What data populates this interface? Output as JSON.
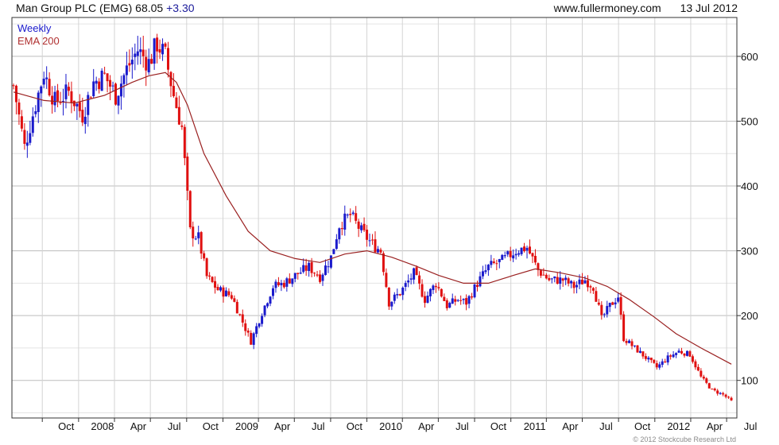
{
  "header": {
    "instrument": "Man Group PLC (EMG)",
    "price": "68.05",
    "change": "+3.30",
    "site": "www.fullermoney.com",
    "date": "13 Jul 2012"
  },
  "legend": {
    "weekly": "Weekly",
    "ema": "EMA 200"
  },
  "copyright": "© 2012 Stockcube Research Ltd",
  "colors": {
    "up": "#1a1acc",
    "down": "#e01010",
    "ema": "#9a2020",
    "grid": "#c8c8c8",
    "frame": "#333333"
  },
  "chart_data": {
    "type": "line",
    "title": "Man Group PLC (EMG)",
    "xlabel": "",
    "ylabel": "",
    "x_ticks": [
      "Oct",
      "2008",
      "Apr",
      "Jul",
      "Oct",
      "2009",
      "Apr",
      "Jul",
      "Oct",
      "2010",
      "Apr",
      "Jul",
      "Oct",
      "2011",
      "Apr",
      "Jul",
      "Oct",
      "2012",
      "Apr",
      "Jul"
    ],
    "y_ticks": [
      100,
      200,
      300,
      400,
      500,
      600
    ],
    "ylim": [
      42,
      660
    ],
    "xlim": [
      "2007-07-16",
      "2012-07-27"
    ],
    "grid": true,
    "legend_position": "top-left",
    "series": [
      {
        "name": "Weekly",
        "style": "candles",
        "anchors": [
          [
            "2007-07-20",
            555
          ],
          [
            "2007-08-17",
            460
          ],
          [
            "2007-09-07",
            510
          ],
          [
            "2007-10-05",
            575
          ],
          [
            "2007-11-02",
            530
          ],
          [
            "2007-12-07",
            545
          ],
          [
            "2008-01-11",
            510
          ],
          [
            "2008-02-08",
            560
          ],
          [
            "2008-03-07",
            570
          ],
          [
            "2008-04-04",
            540
          ],
          [
            "2008-05-02",
            580
          ],
          [
            "2008-05-30",
            610
          ],
          [
            "2008-06-27",
            590
          ],
          [
            "2008-07-18",
            620
          ],
          [
            "2008-08-08",
            600
          ],
          [
            "2008-08-29",
            540
          ],
          [
            "2008-09-19",
            490
          ],
          [
            "2008-10-10",
            330
          ],
          [
            "2008-10-31",
            320
          ],
          [
            "2008-11-21",
            260
          ],
          [
            "2008-12-19",
            240
          ],
          [
            "2009-01-23",
            230
          ],
          [
            "2009-02-20",
            190
          ],
          [
            "2009-03-13",
            160
          ],
          [
            "2009-04-10",
            205
          ],
          [
            "2009-05-08",
            245
          ],
          [
            "2009-06-05",
            250
          ],
          [
            "2009-07-10",
            265
          ],
          [
            "2009-08-07",
            275
          ],
          [
            "2009-09-04",
            260
          ],
          [
            "2009-10-02",
            290
          ],
          [
            "2009-10-23",
            340
          ],
          [
            "2009-11-20",
            355
          ],
          [
            "2009-12-18",
            330
          ],
          [
            "2010-01-15",
            310
          ],
          [
            "2010-02-05",
            300
          ],
          [
            "2010-02-26",
            220
          ],
          [
            "2010-03-26",
            235
          ],
          [
            "2010-04-30",
            265
          ],
          [
            "2010-05-28",
            225
          ],
          [
            "2010-06-25",
            250
          ],
          [
            "2010-07-23",
            215
          ],
          [
            "2010-08-20",
            225
          ],
          [
            "2010-09-10",
            220
          ],
          [
            "2010-10-08",
            250
          ],
          [
            "2010-11-05",
            275
          ],
          [
            "2010-12-10",
            285
          ],
          [
            "2011-01-14",
            300
          ],
          [
            "2011-02-11",
            305
          ],
          [
            "2011-03-11",
            270
          ],
          [
            "2011-04-08",
            255
          ],
          [
            "2011-05-13",
            255
          ],
          [
            "2011-06-10",
            245
          ],
          [
            "2011-07-08",
            255
          ],
          [
            "2011-07-29",
            245
          ],
          [
            "2011-08-19",
            195
          ],
          [
            "2011-09-09",
            215
          ],
          [
            "2011-09-30",
            230
          ],
          [
            "2011-10-14",
            165
          ],
          [
            "2011-11-11",
            150
          ],
          [
            "2011-12-09",
            135
          ],
          [
            "2012-01-06",
            120
          ],
          [
            "2012-02-03",
            135
          ],
          [
            "2012-03-02",
            145
          ],
          [
            "2012-03-30",
            140
          ],
          [
            "2012-04-27",
            105
          ],
          [
            "2012-05-25",
            85
          ],
          [
            "2012-06-22",
            78
          ],
          [
            "2012-07-13",
            68
          ]
        ]
      },
      {
        "name": "EMA 200",
        "style": "line",
        "points": [
          [
            "2007-07-20",
            545
          ],
          [
            "2007-10-05",
            532
          ],
          [
            "2007-12-21",
            528
          ],
          [
            "2008-03-07",
            540
          ],
          [
            "2008-05-16",
            560
          ],
          [
            "2008-06-27",
            570
          ],
          [
            "2008-08-08",
            575
          ],
          [
            "2008-09-05",
            560
          ],
          [
            "2008-10-03",
            525
          ],
          [
            "2008-11-14",
            450
          ],
          [
            "2009-01-09",
            385
          ],
          [
            "2009-03-06",
            330
          ],
          [
            "2009-05-01",
            300
          ],
          [
            "2009-07-03",
            288
          ],
          [
            "2009-09-04",
            282
          ],
          [
            "2009-11-06",
            295
          ],
          [
            "2010-01-01",
            300
          ],
          [
            "2010-03-05",
            290
          ],
          [
            "2010-05-07",
            276
          ],
          [
            "2010-07-02",
            262
          ],
          [
            "2010-09-03",
            250
          ],
          [
            "2010-11-05",
            250
          ],
          [
            "2011-01-07",
            262
          ],
          [
            "2011-03-04",
            272
          ],
          [
            "2011-05-06",
            266
          ],
          [
            "2011-07-08",
            258
          ],
          [
            "2011-09-02",
            245
          ],
          [
            "2011-10-28",
            225
          ],
          [
            "2011-12-30",
            198
          ],
          [
            "2012-02-24",
            172
          ],
          [
            "2012-04-27",
            150
          ],
          [
            "2012-07-13",
            125
          ]
        ]
      }
    ]
  }
}
